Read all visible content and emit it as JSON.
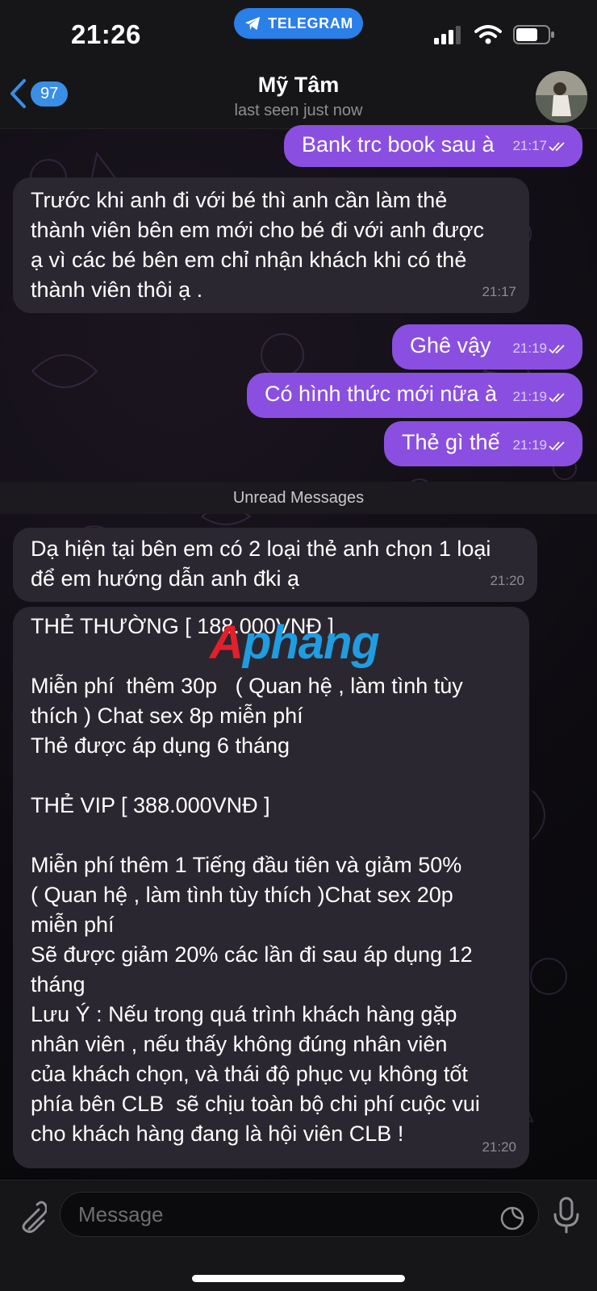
{
  "status_bar": {
    "time": "21:26",
    "app_pill": "TELEGRAM",
    "icons": [
      "signal-icon",
      "wifi-icon",
      "battery-icon"
    ]
  },
  "header": {
    "back_count": "97",
    "contact_name": "Mỹ Tâm",
    "last_seen": "last seen just now"
  },
  "messages": [
    {
      "dir": "out",
      "text": "Bank trc book sau à",
      "time": "21:17",
      "read": true
    },
    {
      "dir": "in",
      "text": "Trước khi anh đi với bé thì anh cần làm thẻ\nthành viên bên em mới cho bé đi với anh được\nạ vì các bé bên em chỉ nhận khách khi có thẻ\nthành viên thôi ạ .",
      "time": "21:17"
    },
    {
      "dir": "out",
      "text": "Ghê vậy",
      "time": "21:19",
      "read": true
    },
    {
      "dir": "out",
      "text": "Có hình thức mới nữa à",
      "time": "21:19",
      "read": true
    },
    {
      "dir": "out",
      "text": "Thẻ gì thế",
      "time": "21:19",
      "read": true
    },
    {
      "dir": "in",
      "text": "Dạ hiện tại bên em có 2 loại thẻ anh chọn 1 loại\nđể em hướng dẫn anh đki ạ",
      "time": "21:20"
    },
    {
      "dir": "in",
      "text": "THẺ THƯỜNG [ 188.000VNĐ ]\n\nMiễn phí  thêm 30p   ( Quan hệ , làm tình tùy\nthích ) Chat sex 8p miễn phí\nThẻ được áp dụng 6 tháng\n\nTHẺ VIP [ 388.000VNĐ ]\n\nMiễn phí thêm 1 Tiếng đầu tiên và giảm 50%\n( Quan hệ , làm tình tùy thích )Chat sex 20p\nmiễn phí\nSẽ được giảm 20% các lần đi sau áp dụng 12\ntháng\nLưu Ý : Nếu trong quá trình khách hàng gặp\nnhân viên , nếu thấy không đúng nhân viên\ncủa khách chọn, và thái độ phục vụ không tốt\nphía bên CLB  sẽ chịu toàn bộ chi phí cuộc vui\ncho khách hàng đang là hội viên CLB !",
      "time": "21:20"
    }
  ],
  "unread_label": "Unread Messages",
  "watermark": {
    "first": "A",
    "rest": "phang"
  },
  "input": {
    "placeholder": "Message"
  },
  "colors": {
    "outgoing": "#8a4fe0",
    "incoming": "#2b2730",
    "accent": "#2b7fe8"
  }
}
